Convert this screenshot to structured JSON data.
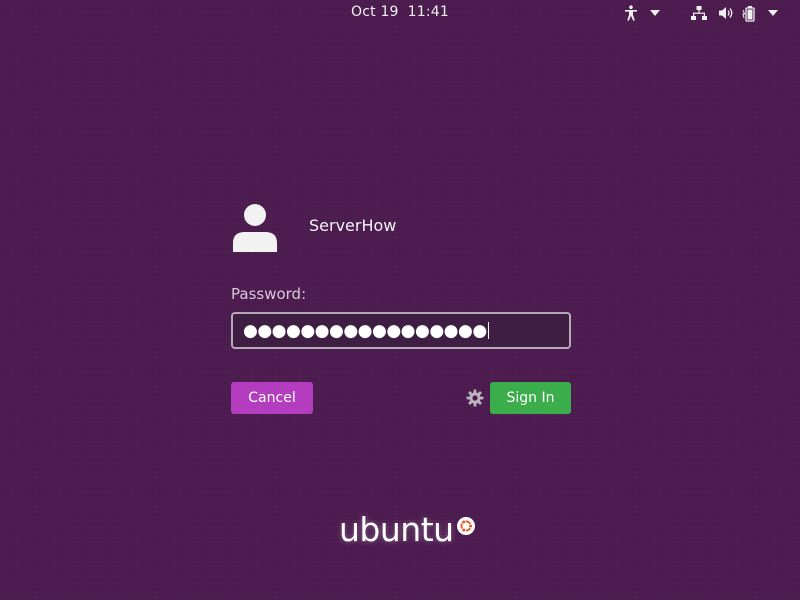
{
  "topbar": {
    "date": "Oct 19",
    "time": "11:41",
    "icons": [
      "accessibility-icon",
      "dropdown-arrow-icon",
      "network-icon",
      "volume-icon",
      "battery-icon",
      "dropdown-arrow-icon"
    ]
  },
  "login": {
    "username": "ServerHow",
    "avatar_icon": "user-avatar-icon",
    "password_label": "Password:",
    "password_mask": "●●●●●●●●●●●●●●●●●",
    "cancel_label": "Cancel",
    "signin_label": "Sign In",
    "session_icon": "gear-icon"
  },
  "branding": {
    "text": "ubuntu",
    "mark_icon": "ubuntu-circle-of-friends-icon"
  },
  "colors": {
    "background": "#4b1a4e",
    "cancel_button": "#b43cbf",
    "signin_button": "#3cad4b",
    "ubuntu_orange": "#e95420"
  }
}
